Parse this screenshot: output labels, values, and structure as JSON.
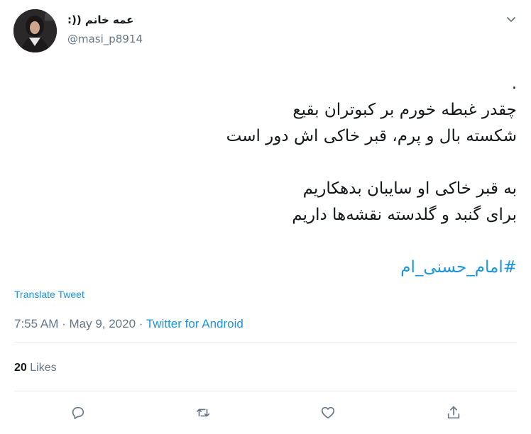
{
  "tweet": {
    "author": {
      "display_name": "عمه خانم ((:",
      "handle": "@masi_p8914",
      "avatar_icon": "profile-photo"
    },
    "body_lines": [
      ".",
      "چقدر غبطه خورم بر کبوتران بقیع",
      "شکسته بال و پرم، قبر خاکی اش دور است",
      "",
      "به قبر خاکی او سایبان بدهکاریم",
      "برای گنبد و گلدسته نقشه‌ها داریم",
      ""
    ],
    "hashtag": "#امام_حسنی_ام",
    "translate_label": "Translate Tweet",
    "timestamp": "7:55 AM · May 9, 2020 · ",
    "source": "Twitter for Android",
    "likes_count": "20",
    "likes_label": " Likes",
    "actions": [
      "reply-icon",
      "retweet-icon",
      "like-icon",
      "share-icon"
    ]
  },
  "colors": {
    "link": "#1b95e0",
    "secondary_text": "#657786",
    "primary_text": "#14171a",
    "divider": "#e6ecf0"
  }
}
